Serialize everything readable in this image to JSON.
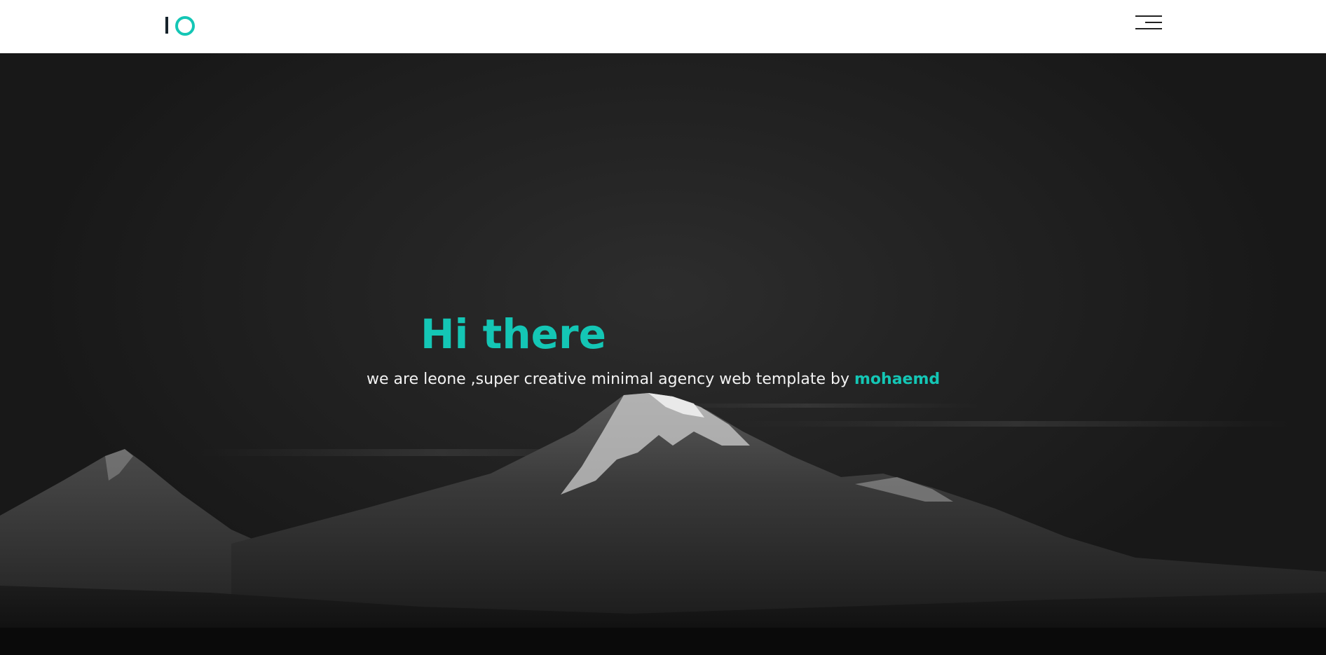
{
  "header": {
    "logo_icon": "io-logo",
    "menu_icon": "hamburger-menu-icon"
  },
  "hero": {
    "title": "Hi there",
    "subtitle_prefix": "we are leone ,super creative minimal agency web template by ",
    "author_link": "mohaemd",
    "background_image": "dark mountain landscape"
  },
  "colors": {
    "accent": "#14c6b5",
    "header_bg": "#ffffff",
    "hero_bg": "#1d1d1d",
    "text_light": "#f3f3f3",
    "logo_dark": "#17232b"
  }
}
